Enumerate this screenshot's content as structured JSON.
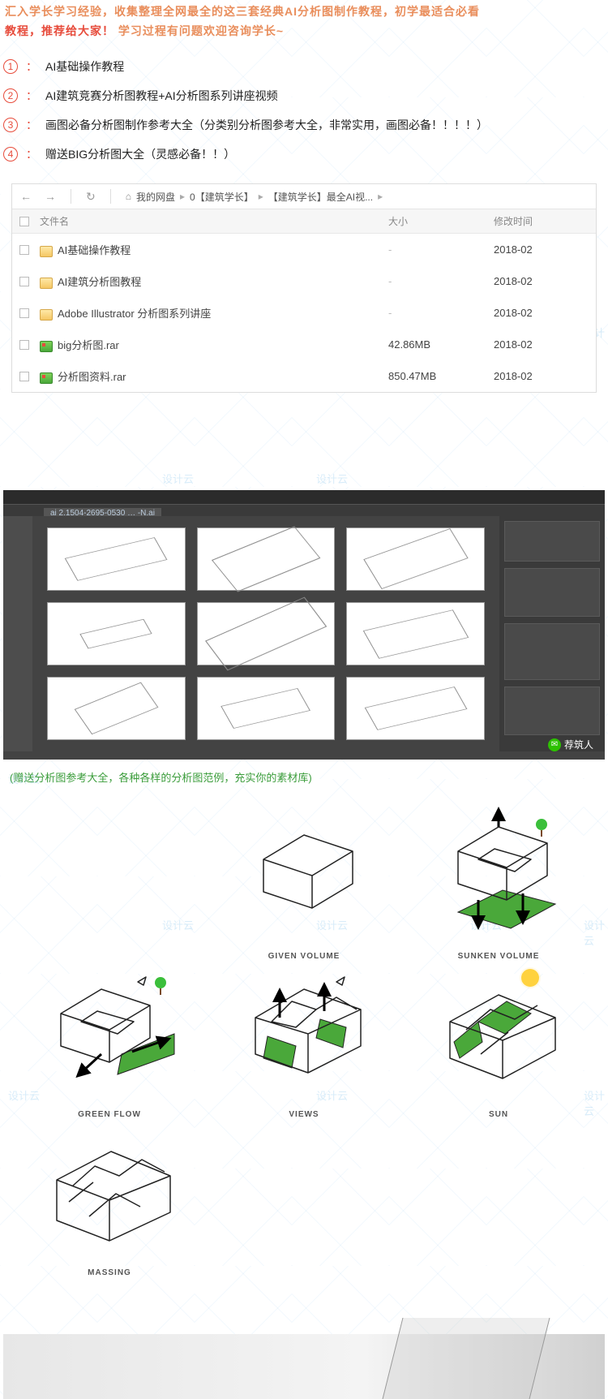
{
  "watermark": "设计云",
  "intro": {
    "line1_partial": "汇入学长学习经验，收集整理全网最全的这三套经典AI分析图制作教程，初学最适合必看",
    "line2_red": "教程，推荐给大家！",
    "line2_orange": "学习过程有问题欢迎咨询学长~"
  },
  "items": [
    {
      "num": "1",
      "text": "AI基础操作教程"
    },
    {
      "num": "2",
      "text": "AI建筑竞赛分析图教程+AI分析图系列讲座视频"
    },
    {
      "num": "3",
      "text": "画图必备分析图制作参考大全（分类别分析图参考大全，非常实用，画图必备！！！！）"
    },
    {
      "num": "4",
      "text": "赠送BIG分析图大全（灵感必备！！）"
    }
  ],
  "browser": {
    "crumbs": [
      "我的网盘",
      "0【建筑学长】",
      "【建筑学长】最全AI视..."
    ],
    "headers": {
      "name": "文件名",
      "size": "大小",
      "date": "修改时间"
    },
    "rows": [
      {
        "icon": "folder",
        "name": "AI基础操作教程",
        "size": "-",
        "date": "2018-02"
      },
      {
        "icon": "folder",
        "name": "AI建筑分析图教程",
        "size": "-",
        "date": "2018-02"
      },
      {
        "icon": "folder",
        "name": "Adobe Illustrator 分析图系列讲座",
        "size": "-",
        "date": "2018-02"
      },
      {
        "icon": "rar",
        "name": "big分析图.rar",
        "size": "42.86MB",
        "date": "2018-02"
      },
      {
        "icon": "rar",
        "name": "分析图资料.rar",
        "size": "850.47MB",
        "date": "2018-02"
      }
    ]
  },
  "ai_tab": "ai 2.1504-2695-0530 … -N.ai",
  "wechat": "荐筑人",
  "caption": "(赠送分析图参考大全，各种各样的分析图范例，充实你的素材库)",
  "diagrams": [
    {
      "label": "GIVEN VOLUME"
    },
    {
      "label": "SUNKEN VOLUME"
    },
    {
      "label": "GREEN FLOW"
    },
    {
      "label": "VIEWS"
    },
    {
      "label": "SUN"
    },
    {
      "label": "MASSING"
    }
  ]
}
